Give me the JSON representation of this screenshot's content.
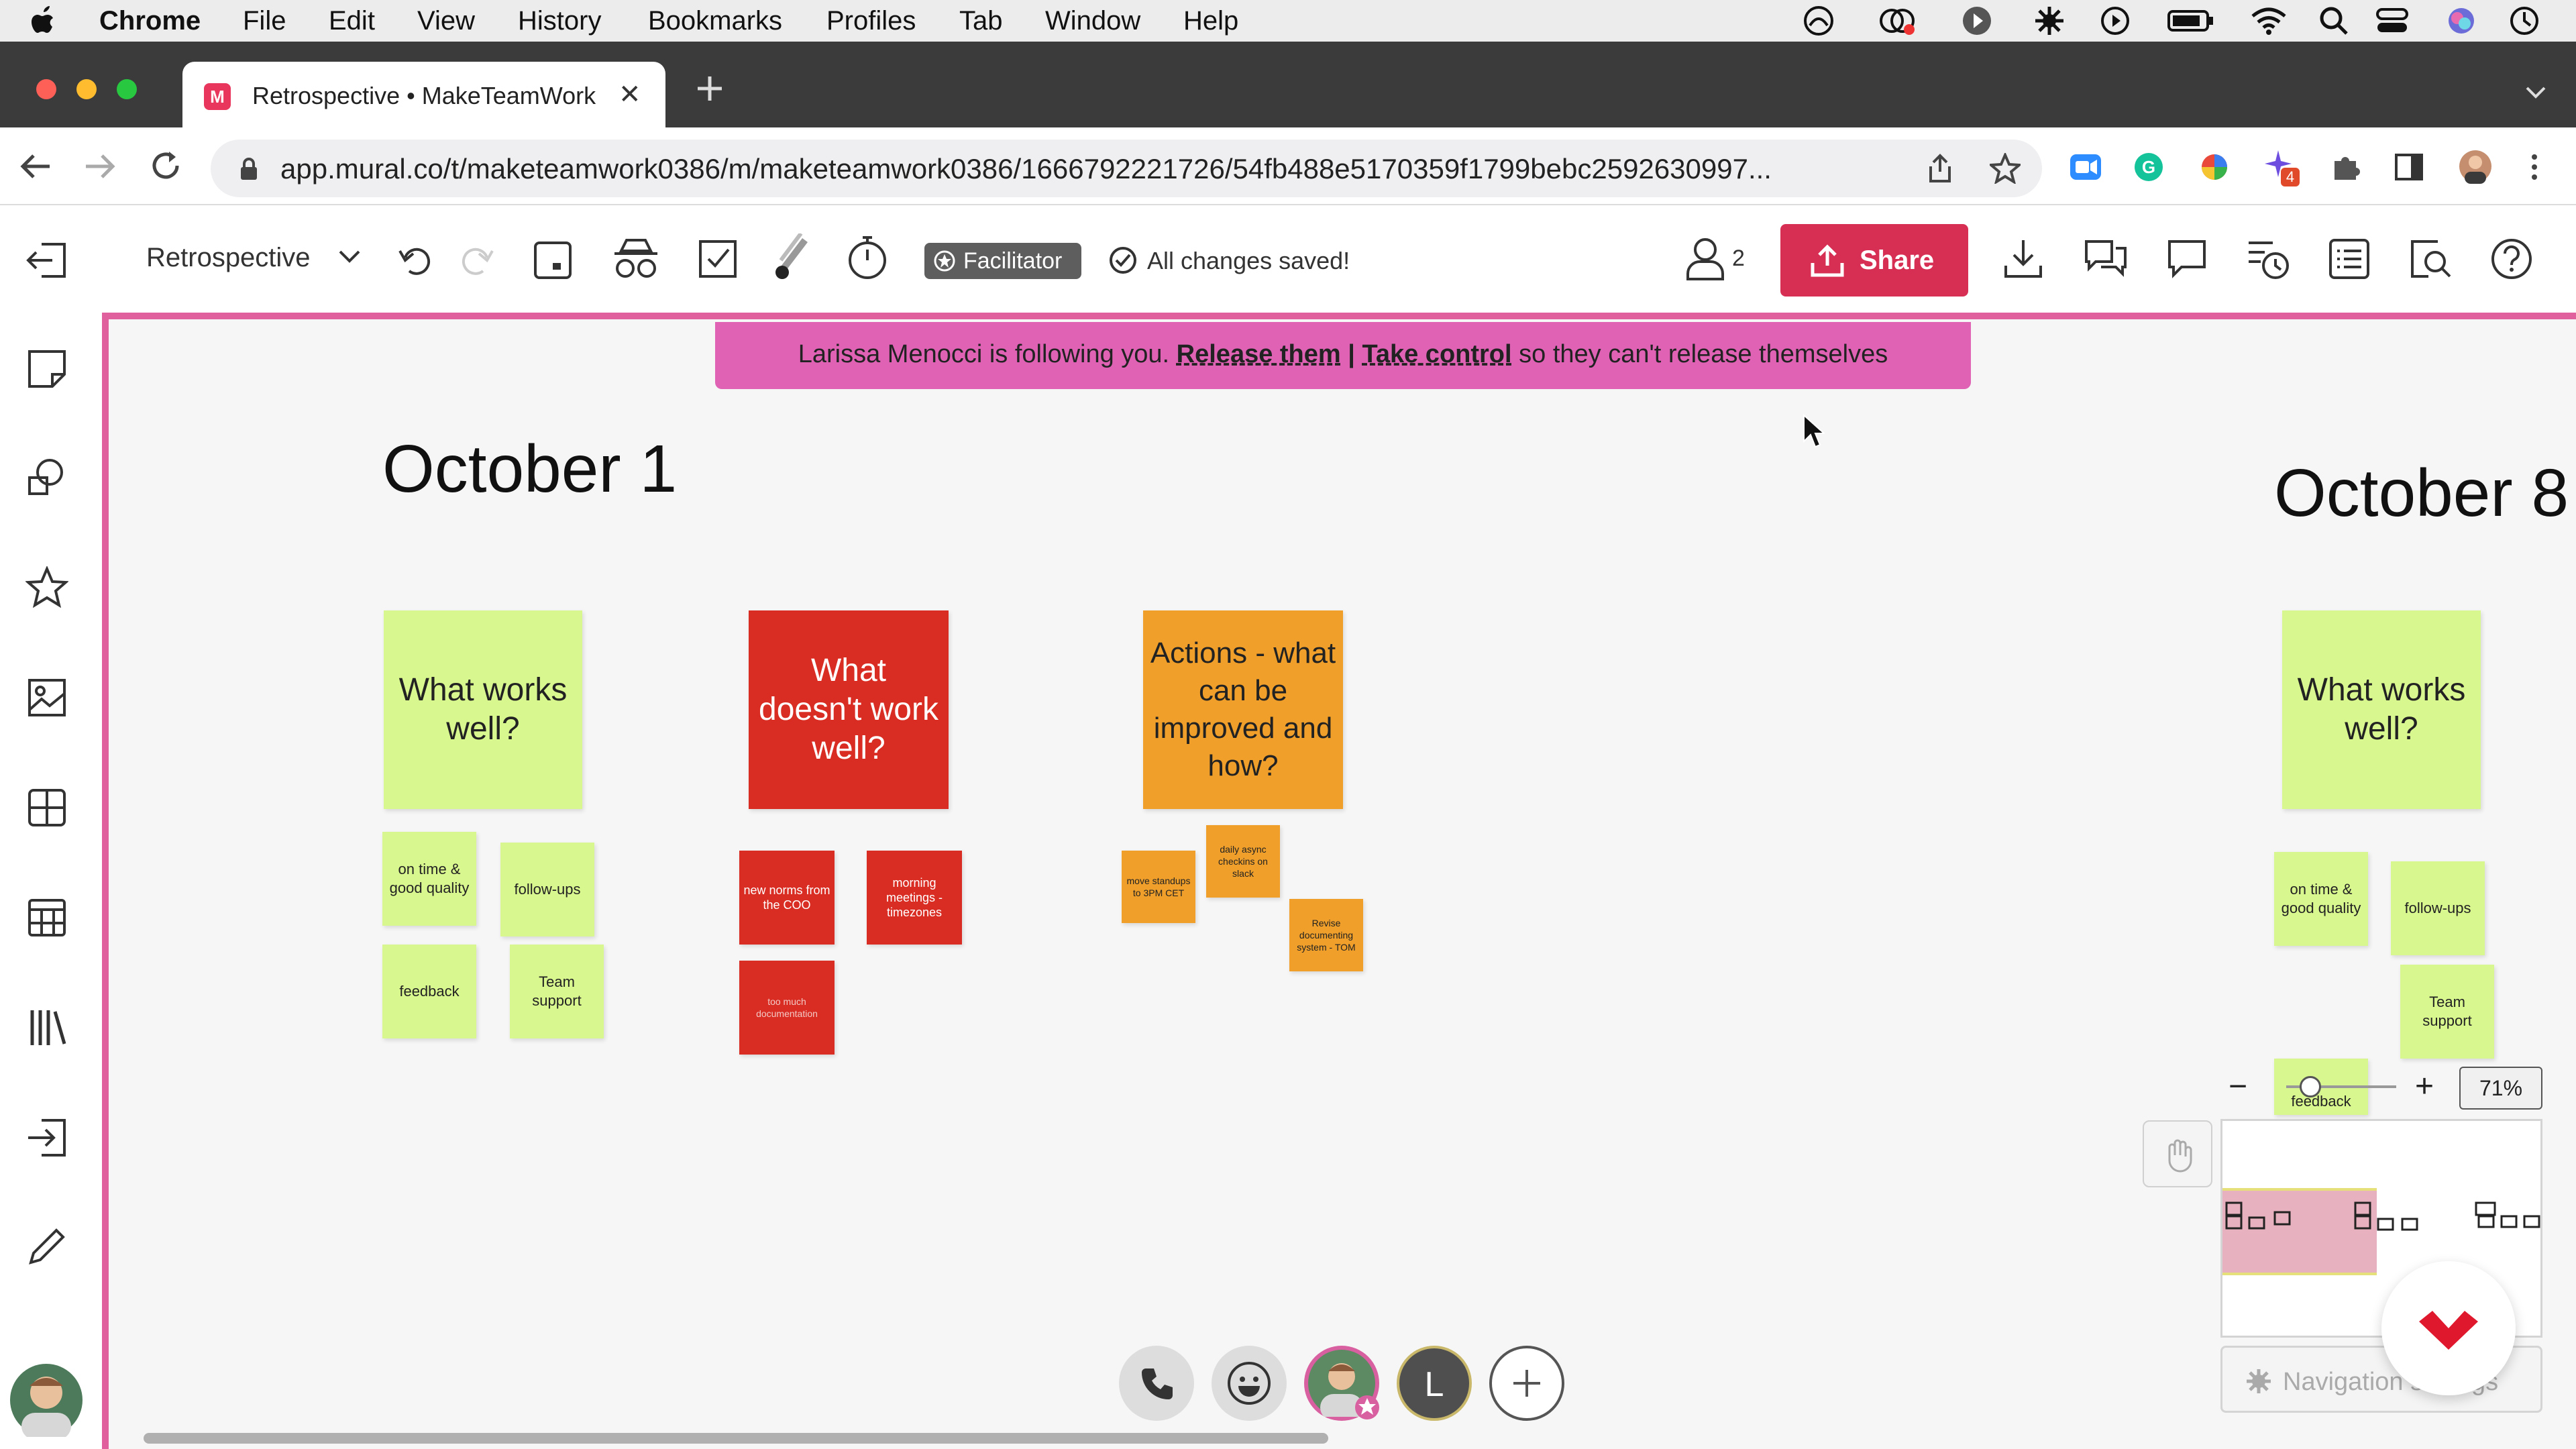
{
  "menubar": {
    "app": "Chrome",
    "items": [
      "File",
      "Edit",
      "View",
      "History",
      "Bookmarks",
      "Profiles",
      "Tab",
      "Window",
      "Help"
    ]
  },
  "browser": {
    "tab_title": "Retrospective • MakeTeamWork",
    "url": "app.mural.co/t/maketeamwork0386/m/maketeamwork0386/1666792221726/54fb488e5170359f1799bebc2592630997...",
    "extension_badge": "4"
  },
  "toolbar": {
    "mural_name": "Retrospective",
    "facilitator_label": "Facilitator",
    "saved_status": "All changes saved!",
    "collaborator_count": "2",
    "share_label": "Share"
  },
  "banner": {
    "prefix": "Larissa Menocci is following you.",
    "release": "Release them",
    "separator": "|",
    "take": "Take control",
    "suffix": "so they can't release themselves"
  },
  "board": {
    "sections": [
      {
        "title": "October 1",
        "columns": [
          {
            "header": "What works well?",
            "color": "#d9f78f",
            "notes": [
              "on time & good quality",
              "follow-ups",
              "feedback",
              "Team support"
            ]
          },
          {
            "header": "What doesn't work well?",
            "color": "#d92d23",
            "notes": [
              "new norms from the COO",
              "morning meetings - timezones",
              "too much documentation"
            ]
          },
          {
            "header": "Actions - what can be improved and how?",
            "color": "#ef9f2a",
            "notes": [
              "move standups to 3PM CET",
              "daily async checkins on slack",
              "Revise documenting system - TOM"
            ]
          }
        ]
      },
      {
        "title": "October 8",
        "columns": [
          {
            "header": "What works well?",
            "color": "#d9f78f",
            "notes": [
              "on time & good quality",
              "follow-ups",
              "Team support",
              "feedback"
            ]
          }
        ]
      }
    ]
  },
  "zoom": {
    "level": "71%",
    "minus": "−",
    "plus": "+",
    "slider_fraction": 0.15
  },
  "navigation": {
    "settings_label": "Navigation settings"
  },
  "participants": {
    "avatar_letter": "L"
  },
  "colors": {
    "accent": "#e0609e",
    "share": "#d72f54",
    "banner": "#df62b4"
  }
}
